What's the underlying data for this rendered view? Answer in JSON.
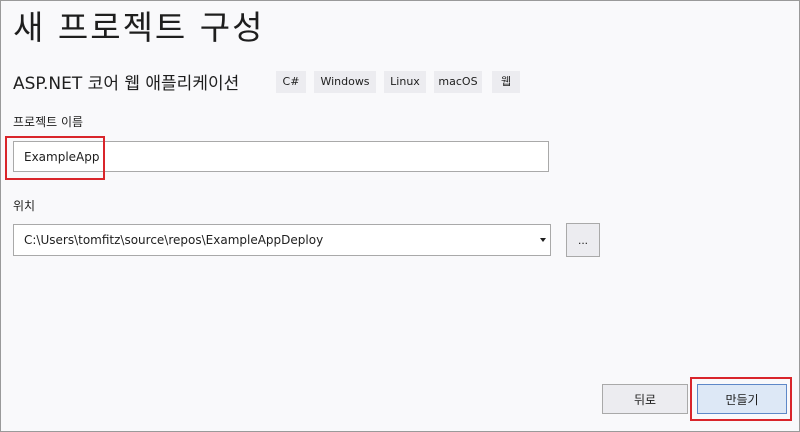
{
  "dialog": {
    "title": "새 프로젝트 구성",
    "template_name": "ASP.NET 코어 웹 애플리케이션",
    "tags": [
      "C#",
      "Windows",
      "Linux",
      "macOS",
      "웹"
    ]
  },
  "project_name": {
    "label": "프로젝트 이름",
    "value": "ExampleApp"
  },
  "location": {
    "label": "위치",
    "value": "C:\\Users\\tomfitz\\source\\repos\\ExampleAppDeploy",
    "browse_label": "..."
  },
  "buttons": {
    "back_label": "뒤로",
    "create_label": "만들기"
  },
  "colors": {
    "highlight": "#d9252b",
    "background": "#f9f9fb",
    "tag_background": "#ececf0",
    "primary_border": "#5e88c8"
  }
}
